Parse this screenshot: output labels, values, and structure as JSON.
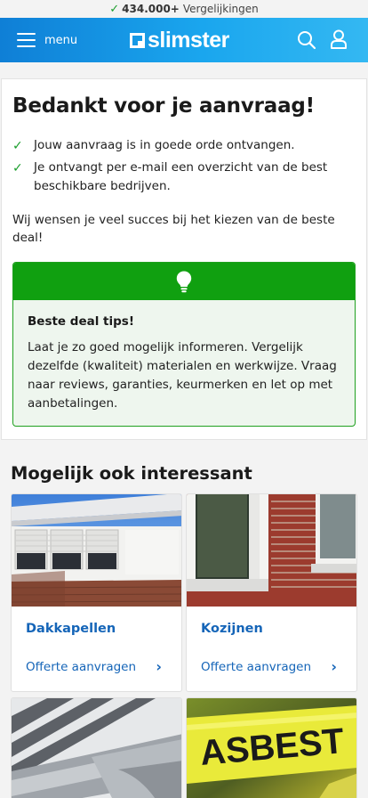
{
  "topbar": {
    "count": "434.000+",
    "text": "Vergelijkingen"
  },
  "header": {
    "menu_label": "menu",
    "logo": "slimster"
  },
  "confirmation": {
    "title": "Bedankt voor je aanvraag!",
    "checks": [
      "Jouw aanvraag is in goede orde ontvangen.",
      "Je ontvangt per e-mail een overzicht van de best beschikbare bedrijven."
    ],
    "wish": "Wij wensen je veel succes bij het kiezen van de beste deal!"
  },
  "tip": {
    "title": "Beste deal tips!",
    "text": "Laat je zo goed mogelijk informeren. Vergelijk dezelfde (kwaliteit) materialen en werkwijze. Vraag naar reviews, garanties, keurmerken en let op met aanbetalingen."
  },
  "related": {
    "title": "Mogelijk ook interessant",
    "tiles": [
      {
        "name": "Dakkapellen",
        "cta": "Offerte aanvragen"
      },
      {
        "name": "Kozijnen",
        "cta": "Offerte aanvragen"
      },
      {
        "name": "",
        "cta": ""
      },
      {
        "name": "",
        "cta": ""
      }
    ],
    "asbest_sign": "ASBEST"
  },
  "colors": {
    "header_blue": "#0f7fd6",
    "tip_green": "#10a010",
    "link_blue": "#1565b8"
  }
}
